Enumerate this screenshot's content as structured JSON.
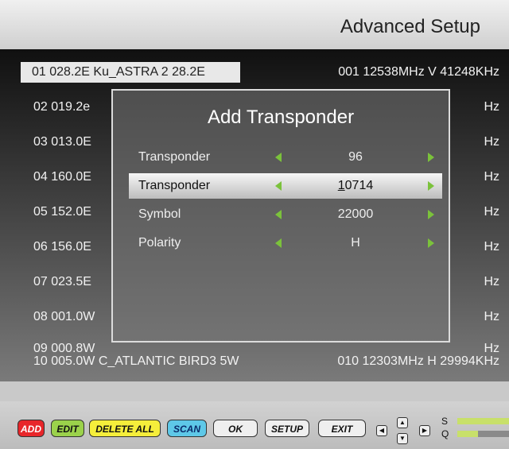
{
  "header": {
    "title": "Advanced Setup"
  },
  "rows": [
    {
      "sat": "01 028.2E Ku_ASTRA 2 28.2E",
      "tp": "001 12538MHz V 41248KHz"
    },
    {
      "sat": "02 019.2e",
      "tp": "Hz"
    },
    {
      "sat": "03 013.0E",
      "tp": "Hz"
    },
    {
      "sat": "04 160.0E",
      "tp": "Hz"
    },
    {
      "sat": "05 152.0E",
      "tp": "Hz"
    },
    {
      "sat": "06 156.0E",
      "tp": "Hz"
    },
    {
      "sat": "07 023.5E",
      "tp": "Hz"
    },
    {
      "sat": "08 001.0W",
      "tp": "Hz"
    },
    {
      "sat": "09 000.8W",
      "tp": "Hz"
    },
    {
      "sat": "10 005.0W C_ATLANTIC BIRD3 5W",
      "tp": "010 12303MHz H 29994KHz"
    }
  ],
  "dialog": {
    "title": "Add Transponder",
    "fields": [
      {
        "label": "Transponder",
        "value": "96"
      },
      {
        "label": "Transponder",
        "value_cursor": "1",
        "value_rest": "0714"
      },
      {
        "label": "Symbol",
        "value": "22000"
      },
      {
        "label": "Polarity",
        "value": "H"
      }
    ]
  },
  "buttons": {
    "add": "ADD",
    "edit": "EDIT",
    "delete_all": "DELETE ALL",
    "scan": "SCAN",
    "ok": "OK",
    "setup": "SETUP",
    "exit": "EXIT"
  },
  "meters": {
    "s_label": "S",
    "q_label": "Q",
    "s_level": 1.0,
    "q_level": 0.4
  },
  "colors": {
    "accent_arrow": "#7bc23b",
    "add": "#e8262a",
    "edit": "#9bd24b",
    "delete_all": "#f5ee3b",
    "scan": "#5ec8e8"
  }
}
